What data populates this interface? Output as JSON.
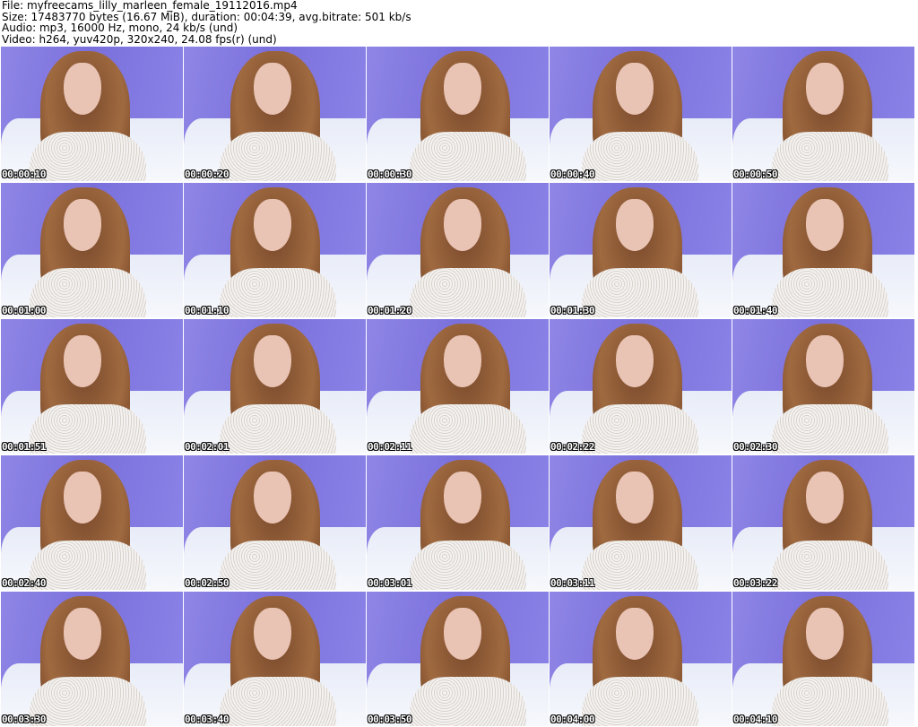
{
  "header": {
    "file": "File: myfreecams_lilly_marleen_female_19112016.mp4",
    "size": "Size: 17483770 bytes (16.67 MiB), duration: 00:04:39, avg.bitrate: 501 kb/s",
    "audio": "Audio: mp3, 16000 Hz, mono, 24 kb/s (und)",
    "video": "Video: h264, yuv420p, 320x240, 24.08 fps(r) (und)"
  },
  "thumbnails": [
    "00:00:10",
    "00:00:20",
    "00:00:30",
    "00:00:40",
    "00:00:50",
    "00:01:00",
    "00:01:10",
    "00:01:20",
    "00:01:30",
    "00:01:40",
    "00:01:51",
    "00:02:01",
    "00:02:11",
    "00:02:22",
    "00:02:30",
    "00:02:40",
    "00:02:50",
    "00:03:01",
    "00:03:11",
    "00:03:22",
    "00:03:30",
    "00:03:40",
    "00:03:50",
    "00:04:00",
    "00:04:10"
  ]
}
